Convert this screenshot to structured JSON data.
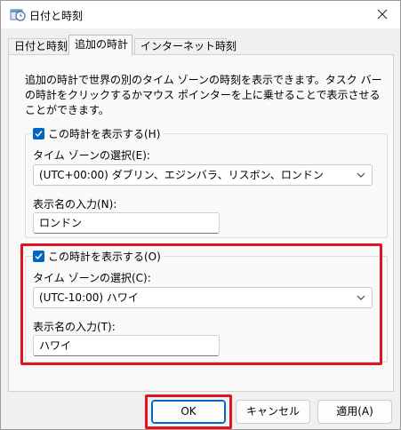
{
  "window": {
    "title": "日付と時刻",
    "app_icon": "clock-calendar-icon",
    "close_icon": "close-icon"
  },
  "tabs": [
    {
      "label": "日付と時刻",
      "active": false
    },
    {
      "label": "追加の時計",
      "active": true
    },
    {
      "label": "インターネット時刻",
      "active": false
    }
  ],
  "description": "追加の時計で世界の別のタイム ゾーンの時刻を表示できます。タスク バーの時計をクリックするかマウス ポインターを上に乗せることで表示させることができます。",
  "clock1": {
    "show_label": "この時計を表示する(H)",
    "checked": true,
    "timezone_label": "タイム ゾーンの選択(E):",
    "timezone_value": "(UTC+00:00) ダブリン、エジンバラ、リスボン、ロンドン",
    "name_label": "表示名の入力(N):",
    "name_value": "ロンドン"
  },
  "clock2": {
    "show_label": "この時計を表示する(O)",
    "checked": true,
    "timezone_label": "タイム ゾーンの選択(C):",
    "timezone_value": "(UTC-10:00) ハワイ",
    "name_label": "表示名の入力(T):",
    "name_value": "ハワイ"
  },
  "buttons": {
    "ok": "OK",
    "cancel": "キャンセル",
    "apply": "適用(A)"
  },
  "colors": {
    "accent": "#0067c0",
    "highlight": "#e0141e"
  }
}
